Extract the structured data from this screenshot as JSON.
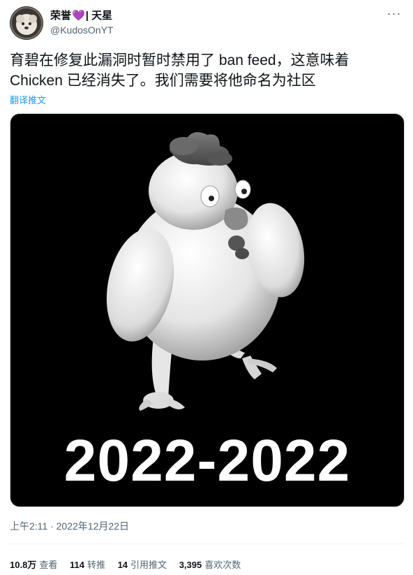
{
  "author": {
    "name": "荣誉",
    "heart": "💜",
    "name_suffix": "| 天星",
    "handle": "@KudosOnYT"
  },
  "tweet": {
    "text_line1": "育碧在修复此漏洞时暂时禁用了 ban feed，这意味着",
    "text_line2": "Chicken 已经消失了。我们需要将他命名为社区",
    "translate_label": "翻译推文",
    "image_caption": "2022-2022",
    "timestamp": "上午2:11 · 2022年12月22日"
  },
  "stats": [
    {
      "value": "10.8万",
      "label": "查看"
    },
    {
      "value": "114",
      "label": "转推"
    },
    {
      "value": "14",
      "label": "引用推文"
    },
    {
      "value": "3,395",
      "label": "喜欢次数"
    }
  ],
  "icons": {
    "more": "more-options-icon"
  },
  "colors": {
    "link": "#1d9bf0",
    "secondary_text": "#536471",
    "heart": "#a98fd6"
  }
}
